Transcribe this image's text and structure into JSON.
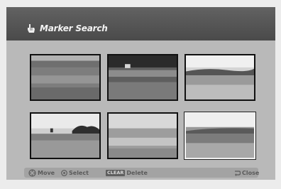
{
  "header": {
    "title": "Marker Search",
    "icon": "hand-pointer-icon"
  },
  "thumbnails": [
    {
      "name": "field-scene-1",
      "selected": false
    },
    {
      "name": "field-scene-2",
      "selected": false
    },
    {
      "name": "field-scene-3",
      "selected": false
    },
    {
      "name": "field-scene-4",
      "selected": false
    },
    {
      "name": "field-scene-5",
      "selected": false
    },
    {
      "name": "field-scene-6",
      "selected": true
    }
  ],
  "footer": {
    "move_label": "Move",
    "select_label": "Select",
    "clear_key": "CLEAR",
    "delete_label": "Delete",
    "close_label": "Close"
  },
  "colors": {
    "header": "#555555",
    "panel": "#b9b9b9",
    "footer_bar": "#a3a3a3",
    "selection_border": "#f0f0f0"
  }
}
